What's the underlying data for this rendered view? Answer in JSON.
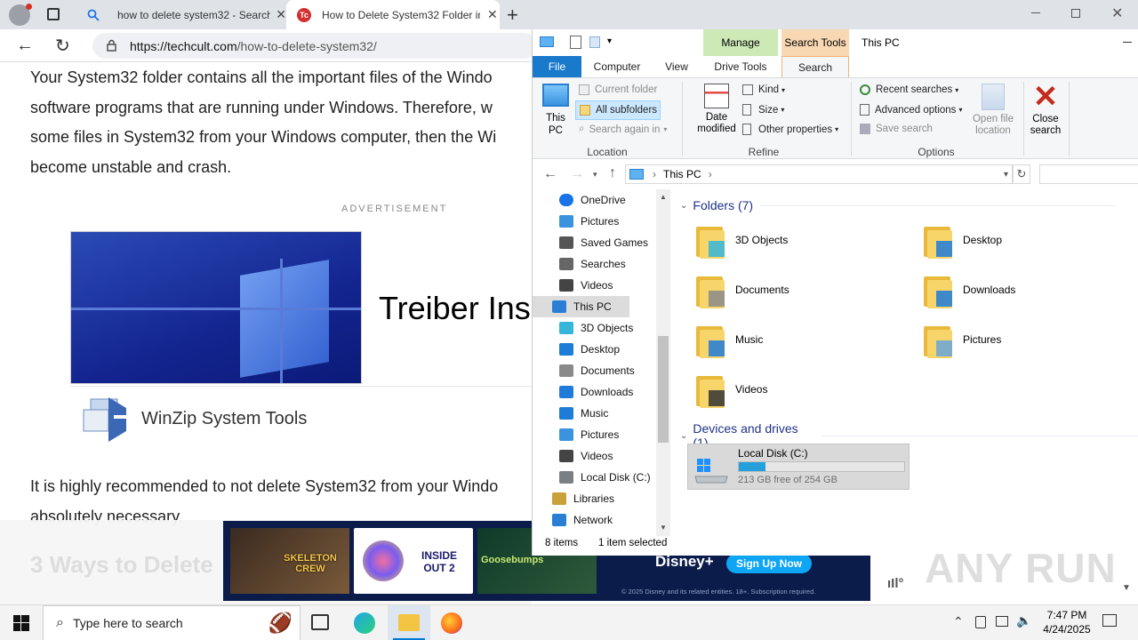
{
  "browser": {
    "tabs": [
      {
        "label": "how to delete system32 - Search"
      },
      {
        "label": "How to Delete System32 Folder in"
      }
    ],
    "url": {
      "domain": "https://techcult.com",
      "path": "/how-to-delete-system32/"
    }
  },
  "article": {
    "lines": [
      "Your System32 folder contains all the important files of the Windo",
      "software programs that are running under Windows. Therefore, w",
      "some files in System32 from your Windows computer, then the Wi",
      "become unstable and crash."
    ],
    "advertisement_label": "ADVERTISEMENT",
    "ad_text": "Treiber Ins",
    "ad_product": "WinZip System Tools",
    "lines2": [
      "It is highly recommended to not delete System32 from your Windo",
      "absolutely necessary."
    ],
    "heading": "3 Ways to Delete",
    "banner": {
      "show1": "SKELETON CREW",
      "show2": "INSIDE OUT 2",
      "show3": "Goosebumps",
      "brand": "Disney+",
      "cta": "Sign Up Now",
      "legal": "© 2025 Disney and its related entities. 18+. Subscription required."
    }
  },
  "explorer": {
    "title": "This PC",
    "context_tabs": {
      "manage": "Manage",
      "search_tools": "Search Tools"
    },
    "tabs": {
      "file": "File",
      "computer": "Computer",
      "view": "View",
      "drive_tools": "Drive Tools",
      "search": "Search"
    },
    "ribbon": {
      "this_pc": "This PC",
      "current_folder": "Current folder",
      "all_subfolders": "All subfolders",
      "search_again": "Search again in",
      "date_modified": "Date modified",
      "kind": "Kind",
      "size": "Size",
      "other_properties": "Other properties",
      "recent_searches": "Recent searches",
      "advanced_options": "Advanced options",
      "save_search": "Save search",
      "open_file_location": "Open file location",
      "close_search": "Close search",
      "groups": {
        "location": "Location",
        "refine": "Refine",
        "options": "Options"
      }
    },
    "address": {
      "path": "This PC"
    },
    "nav": [
      {
        "label": "OneDrive",
        "icon": "cloud-icon"
      },
      {
        "label": "Pictures",
        "icon": "pictures-icon"
      },
      {
        "label": "Saved Games",
        "icon": "saved-games-icon"
      },
      {
        "label": "Searches",
        "icon": "search-icon"
      },
      {
        "label": "Videos",
        "icon": "videos-icon"
      },
      {
        "label": "This PC",
        "icon": "computer-icon"
      },
      {
        "label": "3D Objects",
        "icon": "3d-objects-icon"
      },
      {
        "label": "Desktop",
        "icon": "desktop-icon"
      },
      {
        "label": "Documents",
        "icon": "documents-icon"
      },
      {
        "label": "Downloads",
        "icon": "downloads-icon"
      },
      {
        "label": "Music",
        "icon": "music-icon"
      },
      {
        "label": "Pictures",
        "icon": "pictures-icon"
      },
      {
        "label": "Videos",
        "icon": "videos-icon"
      },
      {
        "label": "Local Disk (C:)",
        "icon": "disk-icon"
      },
      {
        "label": "Libraries",
        "icon": "libraries-icon"
      },
      {
        "label": "Network",
        "icon": "network-icon"
      }
    ],
    "folders_header": "Folders (7)",
    "folders": [
      {
        "label": "3D Objects"
      },
      {
        "label": "Desktop"
      },
      {
        "label": "Documents"
      },
      {
        "label": "Downloads"
      },
      {
        "label": "Music"
      },
      {
        "label": "Pictures"
      },
      {
        "label": "Videos"
      }
    ],
    "drives_header": "Devices and drives (1)",
    "drive": {
      "label": "Local Disk (C:)",
      "free": "213 GB free of 254 GB",
      "used_fraction": 0.16
    },
    "status": {
      "items": "8 items",
      "selected": "1 item selected"
    }
  },
  "taskbar": {
    "search_placeholder": "Type here to search",
    "time": "7:47 PM",
    "date": "4/24/2025"
  },
  "watermark": "ANY RUN",
  "colors": {
    "accent": "#0063b1",
    "manage_tab": "#cde9b6",
    "search_tools_tab": "#f8d7b3",
    "selection": "#cce8ff",
    "drive_bar": "#26a0da"
  }
}
